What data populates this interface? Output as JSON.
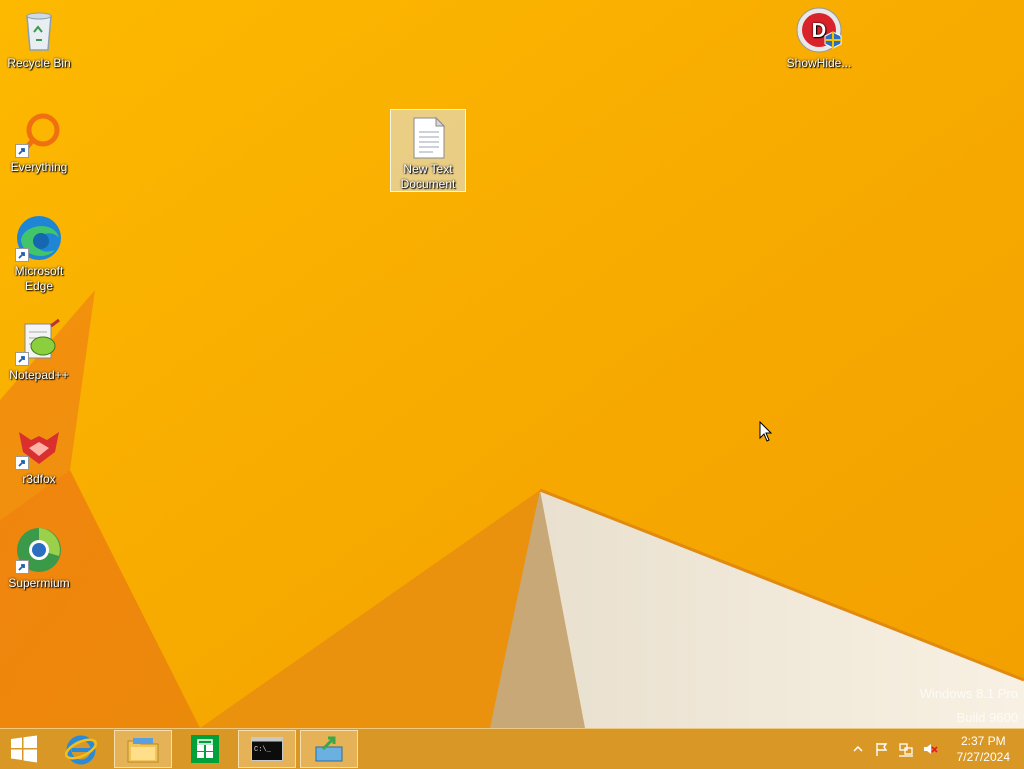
{
  "desktop": {
    "icons": [
      {
        "label": "Recycle Bin"
      },
      {
        "label": "Everything"
      },
      {
        "label": "Microsoft Edge"
      },
      {
        "label": "Notepad++"
      },
      {
        "label": "r3dfox"
      },
      {
        "label": "Supermium"
      },
      {
        "label": "ShowHide..."
      },
      {
        "label": "New Text Document"
      }
    ],
    "watermark": {
      "line1": "Windows 8.1 Pro",
      "line2": "Build 9600"
    }
  },
  "taskbar": {
    "apps": [
      {
        "name": "start-button"
      },
      {
        "name": "internet-explorer"
      },
      {
        "name": "file-explorer"
      },
      {
        "name": "store"
      },
      {
        "name": "command-prompt"
      },
      {
        "name": "app-installer"
      }
    ],
    "clock": {
      "time": "2:37 PM",
      "date": "7/27/2024"
    }
  },
  "colors": {
    "wallpaper": "#f5a800",
    "taskbar": "#d6962a"
  }
}
